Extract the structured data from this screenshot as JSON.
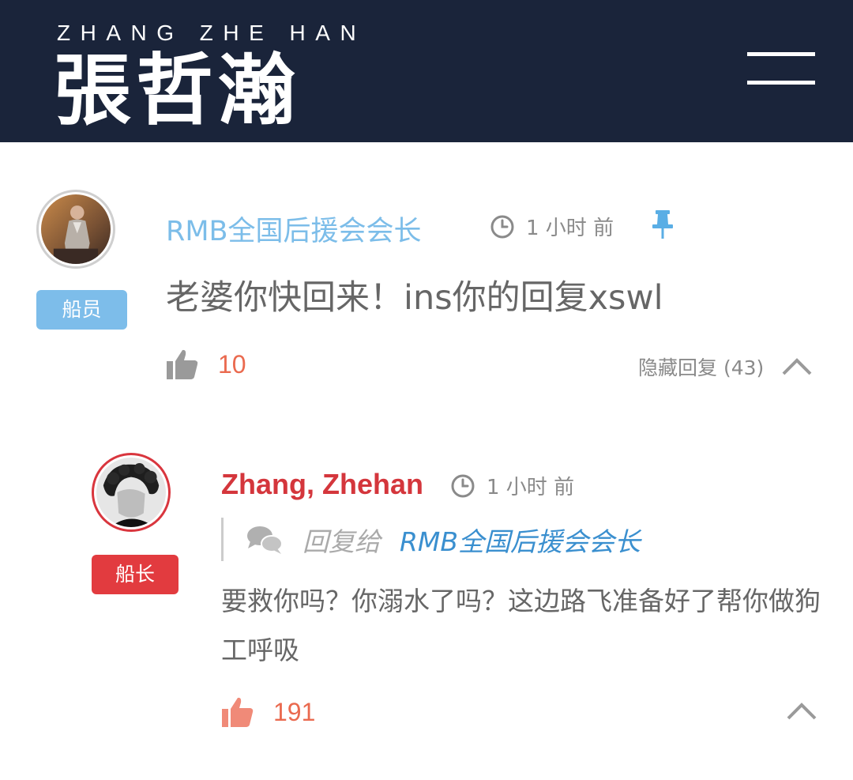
{
  "header": {
    "logo_en": "ZHANG ZHE HAN",
    "logo_zh": "張哲瀚",
    "background_color": "#1a243a",
    "menu_icon": "hamburger-menu-icon"
  },
  "comments": [
    {
      "author": "RMB全国后援会会长",
      "badge": "船员",
      "time": "1 小时 前",
      "pinned": true,
      "text": "老婆你快回来！ins你的回复xswl",
      "likes": "10",
      "toggle_label": "隐藏回复 (43)",
      "author_color": "#7cbde9",
      "badge_color": "#7dbdea"
    },
    {
      "author": "Zhang, Zhehan",
      "badge": "船长",
      "time": "1 小时 前",
      "reply_label": "回复给",
      "reply_target": "RMB全国后援会会长",
      "text": "要救你吗？你溺水了吗？这边路飞准备好了帮你做狗工呼吸",
      "likes": "191",
      "author_color": "#d4363c",
      "badge_color": "#e23b3f"
    }
  ],
  "icons": {
    "clock": "clock-icon",
    "pin": "pin-icon",
    "like": "thumbs-up-icon",
    "reply": "chat-bubbles-icon",
    "collapse": "chevron-up-icon"
  }
}
